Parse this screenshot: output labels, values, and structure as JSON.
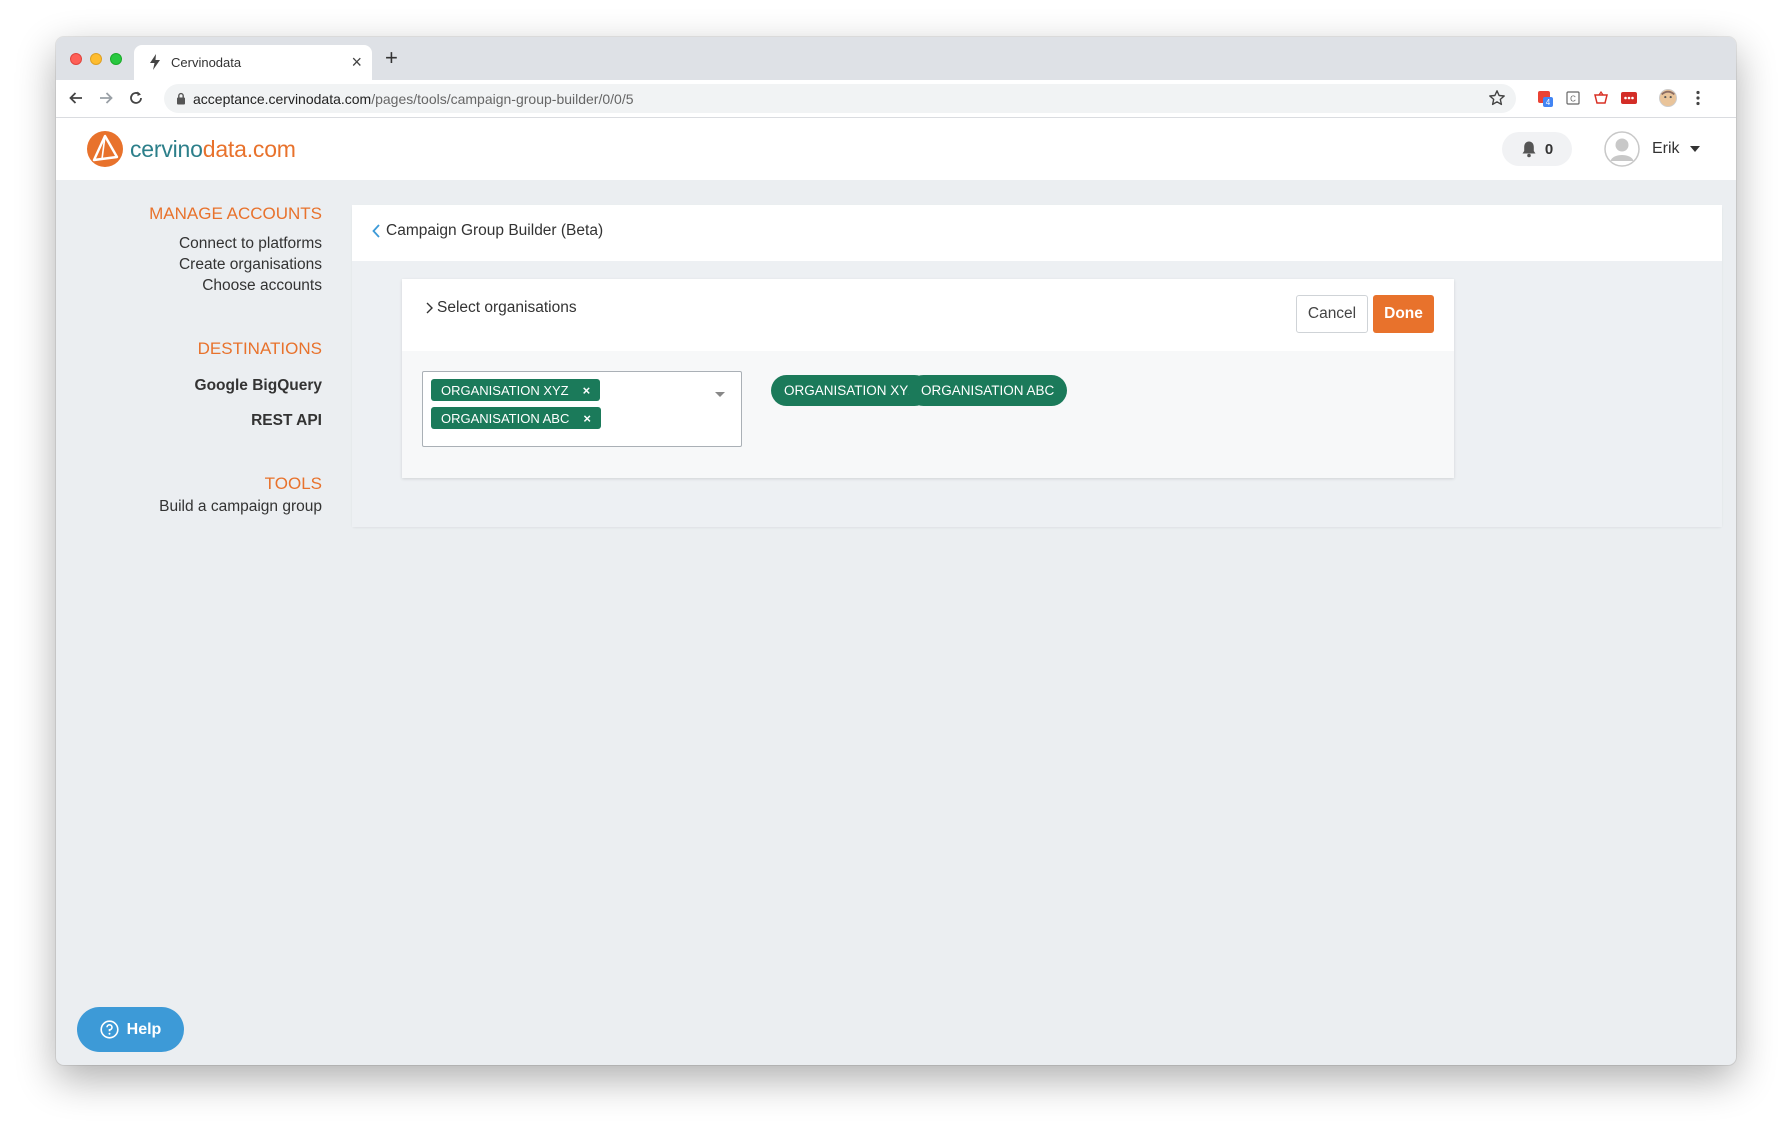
{
  "browser": {
    "tab_title": "Cervinodata",
    "url_host": "acceptance.cervinodata.com",
    "url_path": "/pages/tools/campaign-group-builder/0/0/5",
    "extension_badge": "4"
  },
  "header": {
    "logo_part1": "cervino",
    "logo_part2": "data.com",
    "notification_count": "0",
    "user_name": "Erik"
  },
  "sidebar": {
    "manage_title": "MANAGE ACCOUNTS",
    "manage_items": [
      "Connect to platforms",
      "Create organisations",
      "Choose accounts"
    ],
    "destinations_title": "DESTINATIONS",
    "destinations_items": [
      "Google BigQuery",
      "REST API"
    ],
    "tools_title": "TOOLS",
    "tools_items": [
      "Build a campaign group"
    ]
  },
  "main": {
    "back_label": "Campaign Group Builder (Beta)",
    "step_label": "Select organisations",
    "cancel_label": "Cancel",
    "done_label": "Done",
    "selected_chips": [
      "ORGANISATION XYZ",
      "ORGANISATION ABC"
    ],
    "chip_remove": "×",
    "pills": [
      "ORGANISATION XYZ",
      "ORGANISATION ABC"
    ]
  },
  "help": {
    "label": "Help"
  },
  "colors": {
    "brand_orange": "#e8722c",
    "brand_teal": "#2c7f8a",
    "chip_green": "#1b7a5a",
    "help_blue": "#3d9ad7"
  }
}
